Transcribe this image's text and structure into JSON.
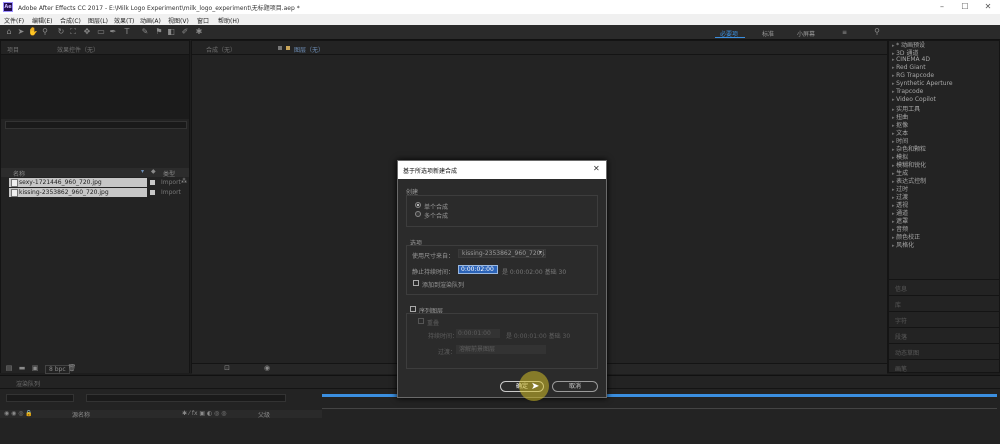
{
  "window": {
    "title": "Adobe After Effects CC 2017 - E:\\Milk Logo Experiment\\milk_logo_experiment\\无标题项目.aep *",
    "logo": "Ae"
  },
  "menu": [
    "文件(F)",
    "编辑(E)",
    "合成(C)",
    "图层(L)",
    "效果(T)",
    "动画(A)",
    "视图(V)",
    "窗口",
    "帮助(H)"
  ],
  "workspace": {
    "active": "必要项",
    "items": [
      "标准",
      "小屏幕"
    ]
  },
  "project_panel": {
    "tab_label": "项目",
    "effects_tab": "效果控件（无）",
    "columns": [
      "名称",
      "类型"
    ],
    "files": [
      {
        "name": "sexy-1721446_960_720.jpg",
        "type": "Import"
      },
      {
        "name": "kissing-2353862_960_720.jpg",
        "type": "Import"
      }
    ],
    "bpc": "8 bpc"
  },
  "comp_panel": {
    "tab_label": "合成（无）",
    "layer_tab": "图层（无）"
  },
  "effects_list": [
    "* 动画预设",
    "3D 通道",
    "CINEMA 4D",
    "Red Giant",
    "RG Trapcode",
    "Synthetic Aperture",
    "Trapcode",
    "Video Copilot",
    "实用工具",
    "扭曲",
    "抠像",
    "文本",
    "时间",
    "杂色和颗粒",
    "模拟",
    "模糊和锐化",
    "生成",
    "表达式控制",
    "过时",
    "过渡",
    "透视",
    "通道",
    "遮罩",
    "音频",
    "颜色校正",
    "风格化"
  ],
  "side_panels": [
    "信息",
    "库",
    "字符",
    "段落",
    "动态草图",
    "画笔"
  ],
  "dialog": {
    "title": "基于所选项新建合成",
    "close": "✕",
    "create_group": "创建",
    "option_single": "单个合成",
    "option_multiple": "多个合成",
    "options_group": "选项",
    "use_dimensions_label": "使用尺寸来自：",
    "use_dimensions_value": "kissing-2353862_960_720.j...",
    "still_duration_label": "静止持续时间：",
    "still_duration_value": "0:00:02:00",
    "still_duration_info": "是 0:00:02:00   基础 30",
    "add_render_queue": "添加到渲染队列",
    "sequence_layers": "序列图层",
    "overlap": "重叠",
    "overlap_duration_label": "持续时间：",
    "overlap_duration_value": "0:00:01:00",
    "overlap_info": "是 0:00:01:00   基础 30",
    "transition_label": "过渡：",
    "transition_value": "溶解前景图层",
    "ok": "确定",
    "cancel": "取消"
  },
  "timeline": {
    "tab_label": "渲染队列",
    "source_name": "源名称",
    "parent": "父级"
  }
}
